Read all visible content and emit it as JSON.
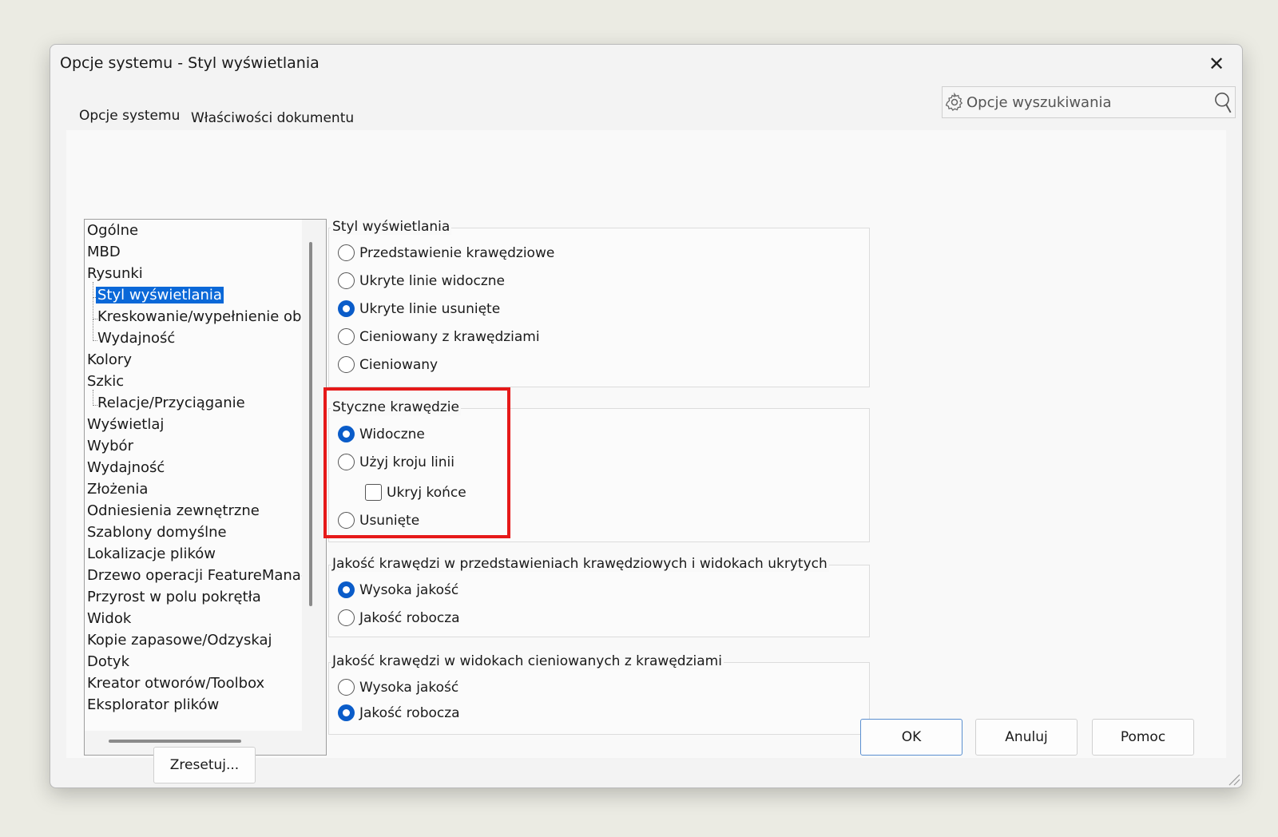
{
  "window": {
    "title": "Opcje systemu - Styl wyświetlania",
    "close_glyph": "✕"
  },
  "search": {
    "placeholder": "Opcje wyszukiwania"
  },
  "tabs": [
    {
      "label": "Opcje systemu",
      "active": true
    },
    {
      "label": "Właściwości dokumentu",
      "active": false
    }
  ],
  "tree": {
    "items": [
      {
        "label": "Ogólne",
        "level": 0
      },
      {
        "label": "MBD",
        "level": 0
      },
      {
        "label": "Rysunki",
        "level": 0
      },
      {
        "label": "Styl wyświetlania",
        "level": 1,
        "selected": true
      },
      {
        "label": "Kreskowanie/wypełnienie obsza",
        "level": 1
      },
      {
        "label": "Wydajność",
        "level": 1
      },
      {
        "label": "Kolory",
        "level": 0
      },
      {
        "label": "Szkic",
        "level": 0
      },
      {
        "label": "Relacje/Przyciąganie",
        "level": 1
      },
      {
        "label": "Wyświetlaj",
        "level": 0
      },
      {
        "label": "Wybór",
        "level": 0
      },
      {
        "label": "Wydajność",
        "level": 0
      },
      {
        "label": "Złożenia",
        "level": 0
      },
      {
        "label": "Odniesienia zewnętrzne",
        "level": 0
      },
      {
        "label": "Szablony domyślne",
        "level": 0
      },
      {
        "label": "Lokalizacje plików",
        "level": 0
      },
      {
        "label": "Drzewo operacji FeatureManager",
        "level": 0
      },
      {
        "label": "Przyrost w polu pokrętła",
        "level": 0
      },
      {
        "label": "Widok",
        "level": 0
      },
      {
        "label": "Kopie zapasowe/Odzyskaj",
        "level": 0
      },
      {
        "label": "Dotyk",
        "level": 0
      },
      {
        "label": "Kreator otworów/Toolbox",
        "level": 0
      },
      {
        "label": "Eksplorator plików",
        "level": 0
      }
    ]
  },
  "groups": {
    "display_style": {
      "title": "Styl wyświetlania",
      "options": [
        {
          "label": "Przedstawienie krawędziowe",
          "selected": false
        },
        {
          "label": "Ukryte linie widoczne",
          "selected": false
        },
        {
          "label": "Ukryte linie usunięte",
          "selected": true
        },
        {
          "label": "Cieniowany z krawędziami",
          "selected": false
        },
        {
          "label": "Cieniowany",
          "selected": false
        }
      ]
    },
    "tangent_edges": {
      "title": "Styczne krawędzie",
      "options": [
        {
          "label": "Widoczne",
          "selected": true
        },
        {
          "label": "Użyj kroju linii",
          "selected": false
        },
        {
          "label": "Usunięte",
          "selected": false
        }
      ],
      "checkbox": {
        "label": "Ukryj końce",
        "checked": false
      }
    },
    "edge_quality_wireframe": {
      "title": "Jakość krawędzi w przedstawieniach krawędziowych i widokach ukrytych",
      "options": [
        {
          "label": "Wysoka jakość",
          "selected": true
        },
        {
          "label": "Jakość robocza",
          "selected": false
        }
      ]
    },
    "edge_quality_shaded": {
      "title": "Jakość krawędzi w widokach cieniowanych z krawędziami",
      "options": [
        {
          "label": "Wysoka jakość",
          "selected": false
        },
        {
          "label": "Jakość robocza",
          "selected": true
        }
      ]
    }
  },
  "buttons": {
    "reset": "Zresetuj...",
    "ok": "OK",
    "cancel": "Anuluj",
    "help": "Pomoc"
  },
  "colors": {
    "accent": "#0a5cc9",
    "selection": "#0a68d8",
    "highlight_box": "#e61919"
  }
}
